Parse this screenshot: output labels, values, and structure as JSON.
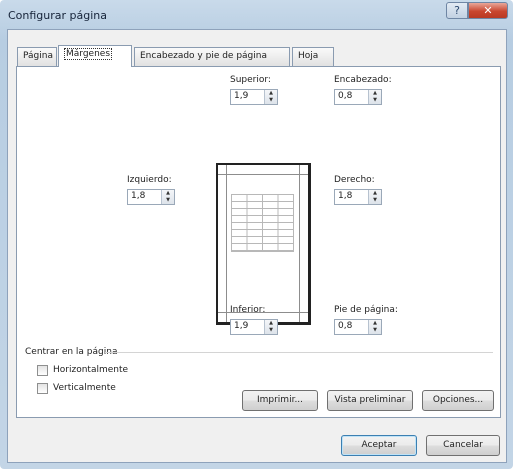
{
  "window": {
    "title": "Configurar página"
  },
  "tabs": [
    "Página",
    "Márgenes",
    "Encabezado y pie de página",
    "Hoja"
  ],
  "margins": {
    "superior": {
      "label": "Superior:",
      "value": "1,9"
    },
    "encabezado": {
      "label": "Encabezado:",
      "value": "0,8"
    },
    "izquierdo": {
      "label": "Izquierdo:",
      "value": "1,8"
    },
    "derecho": {
      "label": "Derecho:",
      "value": "1,8"
    },
    "inferior": {
      "label": "Inferior:",
      "value": "1,9"
    },
    "pie": {
      "label": "Pie de página:",
      "value": "0,8"
    }
  },
  "center": {
    "title": "Centrar en la página",
    "horizontal": {
      "label": "Horizontalmente",
      "checked": false
    },
    "vertical": {
      "label": "Verticalmente",
      "checked": false
    }
  },
  "buttons": {
    "imprimir": "Imprimir...",
    "vista_previa": "Vista preliminar",
    "opciones": "Opciones...",
    "aceptar": "Aceptar",
    "cancelar": "Cancelar"
  },
  "icons": {
    "help": "help-icon",
    "close": "close-icon",
    "spin": "spin-arrows-icon"
  }
}
